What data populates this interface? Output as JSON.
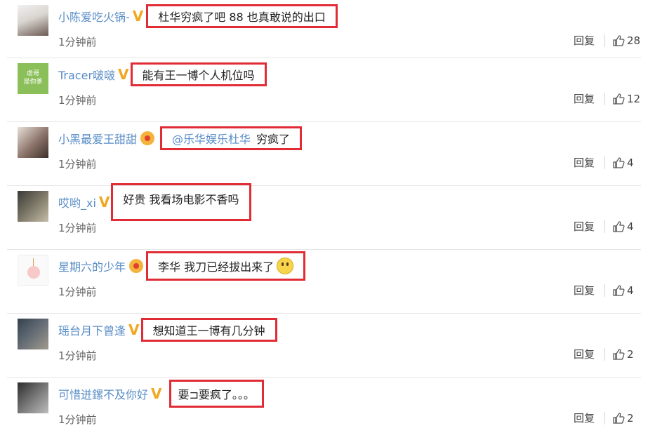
{
  "comments": [
    {
      "user": "小陈爱吃火锅-",
      "badge": "V",
      "text": "杜华穷疯了吧 88 也真敢说的出口",
      "time": "1分钟前",
      "reply": "回复",
      "likes": "28"
    },
    {
      "user": "Tracer啵啵",
      "badge": "V",
      "text": "能有王一博个人机位吗",
      "time": "1分钟前",
      "reply": "回复",
      "likes": "12",
      "avatar_text": "虐哥\n是你爹"
    },
    {
      "user": "小黑最爱王甜甜",
      "badge": "crown",
      "mention": "@乐华娱乐杜华",
      "text": "穷疯了",
      "time": "1分钟前",
      "reply": "回复",
      "likes": "4"
    },
    {
      "user": "哎哟_xi",
      "badge": "V",
      "text": "好贵 我看场电影不香吗",
      "time": "1分钟前",
      "reply": "回复",
      "likes": "4"
    },
    {
      "user": "星期六的少年",
      "badge": "crown",
      "text": "李华 我刀已经拔出来了",
      "emoji": "smile-emoji",
      "time": "1分钟前",
      "reply": "回复",
      "likes": "4"
    },
    {
      "user": "瑶台月下曾逢",
      "badge": "V",
      "text": "想知道王一博有几分钟",
      "time": "1分钟前",
      "reply": "回复",
      "likes": "2"
    },
    {
      "user": "可惜迸鏍不及你好",
      "badge": "V",
      "text": "要⊐要疯了。。。",
      "time": "1分钟前",
      "reply": "回复",
      "likes": "2"
    }
  ],
  "colors": {
    "username": "#5a8ec7",
    "highlight_box": "#e12c36",
    "vip_badge": "#f0a722"
  },
  "icons": {
    "like": "thumbs-up-icon",
    "badge_v": "vip-v-icon",
    "badge_crown": "crown-icon"
  }
}
